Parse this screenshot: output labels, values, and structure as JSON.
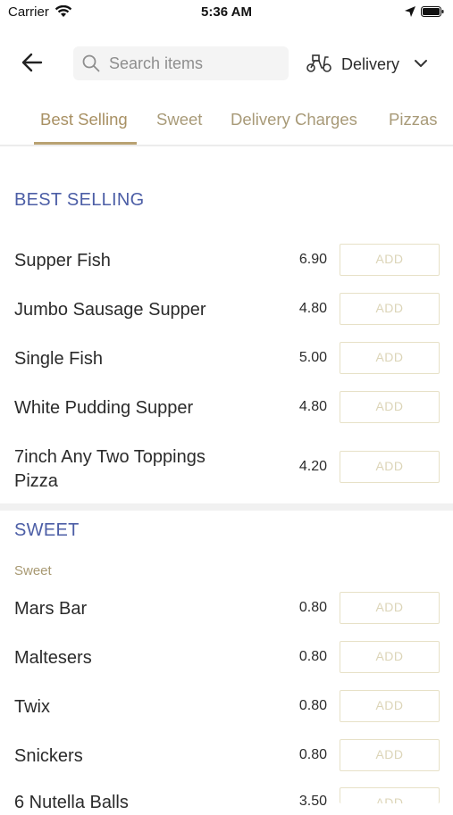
{
  "status": {
    "carrier": "Carrier",
    "time": "5:36 AM"
  },
  "search": {
    "placeholder": "Search items"
  },
  "delivery": {
    "label": "Delivery"
  },
  "tabs": [
    "Best Selling",
    "Sweet",
    "Delivery Charges",
    "Pizzas"
  ],
  "active_tab": "Best Selling",
  "sections": [
    {
      "title": "BEST SELLING",
      "items": [
        {
          "name": "Supper Fish",
          "price": "6.90"
        },
        {
          "name": "Jumbo Sausage Supper",
          "price": "4.80"
        },
        {
          "name": "Single Fish",
          "price": "5.00"
        },
        {
          "name": "White Pudding Supper",
          "price": "4.80"
        },
        {
          "name": "7inch Any Two Toppings Pizza",
          "price": "4.20"
        }
      ]
    },
    {
      "title": "SWEET",
      "subcategory": "Sweet",
      "items": [
        {
          "name": "Mars Bar",
          "price": "0.80"
        },
        {
          "name": "Maltesers",
          "price": "0.80"
        },
        {
          "name": "Twix",
          "price": "0.80"
        },
        {
          "name": "Snickers",
          "price": "0.80"
        },
        {
          "name": "6 Nutella Balls",
          "price": "3.50"
        }
      ]
    }
  ],
  "add_label": "ADD",
  "colors": {
    "accent_gold": "#b9a272",
    "section_blue": "#4c5ea6",
    "add_border": "#e7e1c7"
  },
  "icons": [
    "wifi-icon",
    "location-arrow-icon",
    "battery-icon",
    "back-arrow-icon",
    "search-icon",
    "scooter-icon",
    "chevron-down-icon"
  ]
}
